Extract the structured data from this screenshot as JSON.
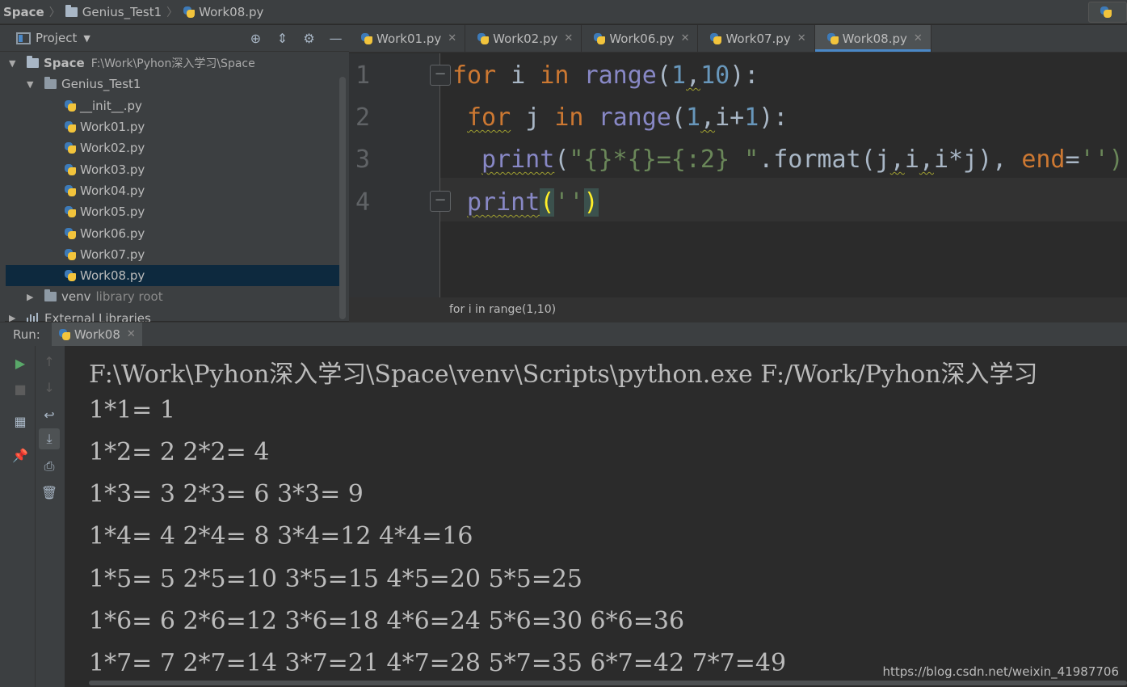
{
  "navbar": {
    "crumbs": [
      "Space",
      "Genius_Test1",
      "Work08.py"
    ]
  },
  "project": {
    "title": "Project",
    "tree": {
      "root_name": "Space",
      "root_path": "F:\\Work\\Pyhon深入学习\\Space",
      "folder": "Genius_Test1",
      "files": [
        "__init__.py",
        "Work01.py",
        "Work02.py",
        "Work03.py",
        "Work04.py",
        "Work05.py",
        "Work06.py",
        "Work07.py",
        "Work08.py"
      ],
      "selected": "Work08.py",
      "venv_name": "venv",
      "venv_note": "library root",
      "external": "External Libraries"
    }
  },
  "editor": {
    "tabs": [
      "Work01.py",
      "Work02.py",
      "Work06.py",
      "Work07.py",
      "Work08.py"
    ],
    "active_tab": "Work08.py",
    "line_numbers": [
      "1",
      "2",
      "3",
      "4"
    ],
    "code": {
      "l1": {
        "kw_for": "for",
        "v1": " i ",
        "kw_in": "in",
        "sp": " ",
        "fn": "range",
        "open": "(",
        "n1": "1",
        "comma": ",",
        "n2": "10",
        "close": "):"
      },
      "l2": {
        "kw_for": "for",
        "v1": " j ",
        "kw_in": "in",
        "sp": " ",
        "fn": "range",
        "open": "(",
        "n1": "1",
        "comma": ",",
        "rest": "i+",
        "n2": "1",
        "close": "):"
      },
      "l3": {
        "fn": "print",
        "open": "(",
        "str": "\"{}*{}={:2} \"",
        "mid": ".format(j",
        "c1": ",",
        "a": "i",
        "c2": ",",
        "b": "i*j),",
        "sp": " ",
        "kw_end": "end",
        "eq": "=",
        "s2": "'')"
      },
      "l4": {
        "fn": "print",
        "p1": "(",
        "s": "''",
        "p2": ")"
      }
    },
    "breadcrumb_status": "for i in range(1,10)"
  },
  "run": {
    "label": "Run:",
    "tab": "Work08",
    "output": [
      "F:\\Work\\Pyhon深入学习\\Space\\venv\\Scripts\\python.exe F:/Work/Pyhon深入学习",
      "1*1= 1",
      "1*2= 2 2*2= 4",
      "1*3= 3 2*3= 6 3*3= 9",
      "1*4= 4 2*4= 8 3*4=12 4*4=16",
      "1*5= 5 2*5=10 3*5=15 4*5=20 5*5=25",
      "1*6= 6 2*6=12 3*6=18 4*6=24 5*6=30 6*6=36",
      "1*7= 7 2*7=14 3*7=21 4*7=28 5*7=35 6*7=42 7*7=49"
    ],
    "watermark": "https://blog.csdn.net/weixin_41987706"
  },
  "colors": {
    "keyword": "#cc7832",
    "builtin": "#8888c6",
    "number": "#6897bb",
    "string": "#6a8759",
    "selection": "#0d293e",
    "accent": "#4a88c7"
  }
}
